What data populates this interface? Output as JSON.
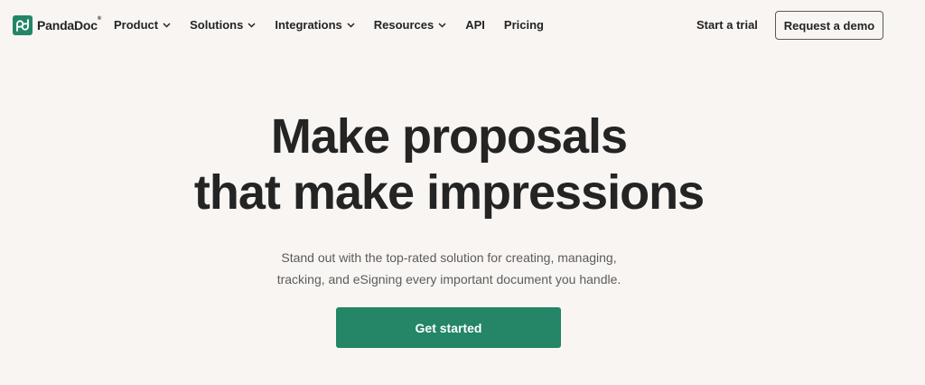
{
  "brand": {
    "name": "PandaDoc",
    "registered_mark": "®",
    "logo_icon": "pandadoc-logo-icon",
    "color": "#248567"
  },
  "nav": {
    "items": [
      {
        "label": "Product",
        "has_dropdown": true
      },
      {
        "label": "Solutions",
        "has_dropdown": true
      },
      {
        "label": "Integrations",
        "has_dropdown": true
      },
      {
        "label": "Resources",
        "has_dropdown": true
      },
      {
        "label": "API",
        "has_dropdown": false
      },
      {
        "label": "Pricing",
        "has_dropdown": false
      }
    ],
    "start_trial": "Start a trial",
    "request_demo": "Request a demo"
  },
  "hero": {
    "title_line1": "Make proposals",
    "title_line2": "that make impressions",
    "subtitle_line1": "Stand out with the top-rated solution for creating, managing,",
    "subtitle_line2": "tracking, and eSigning every important document you handle.",
    "cta_label": "Get started"
  },
  "colors": {
    "background": "#f8f5f3",
    "text": "#242424",
    "accent": "#248567"
  }
}
